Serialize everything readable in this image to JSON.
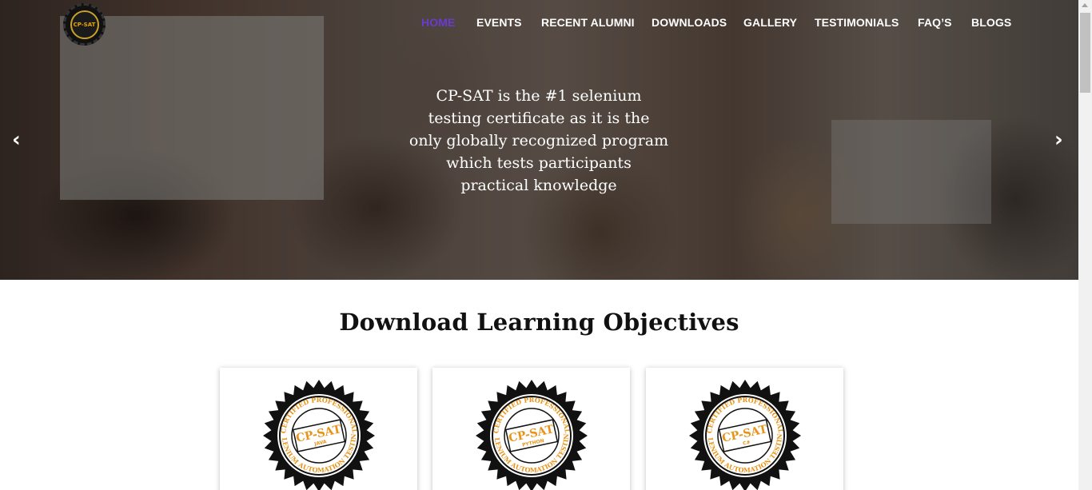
{
  "logo": {
    "text": "CP-SAT"
  },
  "nav": {
    "items": [
      {
        "label": "HOME",
        "active": true
      },
      {
        "label": "EVENTS"
      },
      {
        "label": "RECENT ALUMNI"
      },
      {
        "label": "DOWNLOADS"
      },
      {
        "label": "GALLERY"
      },
      {
        "label": "TESTIMONIALS"
      },
      {
        "label": "FAQ’S"
      },
      {
        "label": "BLOGS"
      }
    ]
  },
  "hero": {
    "lines": [
      "CP-SAT is the #1 selenium",
      "testing certificate as it is the",
      "only globally recognized program",
      "which tests participants",
      "practical knowledge"
    ],
    "prev_icon": "chevron-left-icon",
    "next_icon": "chevron-right-icon"
  },
  "section": {
    "title": "Download Learning Objectives"
  },
  "cards": [
    {
      "seal_title": "CP-SAT",
      "seal_sub": "JAVA",
      "ring_top": "CERTIFIED PROFESSIONAL",
      "ring_bottom": "SELENIUM AUTOMATION TESTING"
    },
    {
      "seal_title": "CP-SAT",
      "seal_sub": "PYTHON",
      "ring_top": "CERTIFIED PROFESSIONAL",
      "ring_bottom": "SELENIUM AUTOMATION TESTING"
    },
    {
      "seal_title": "CP-SAT",
      "seal_sub": "C#",
      "ring_top": "CERTIFIED PROFESSIONAL",
      "ring_bottom": "SELENIUM AUTOMATION TESTING"
    }
  ],
  "colors": {
    "nav_active": "#6a3ad1",
    "seal_orange": "#e8941a",
    "seal_black": "#111111"
  }
}
